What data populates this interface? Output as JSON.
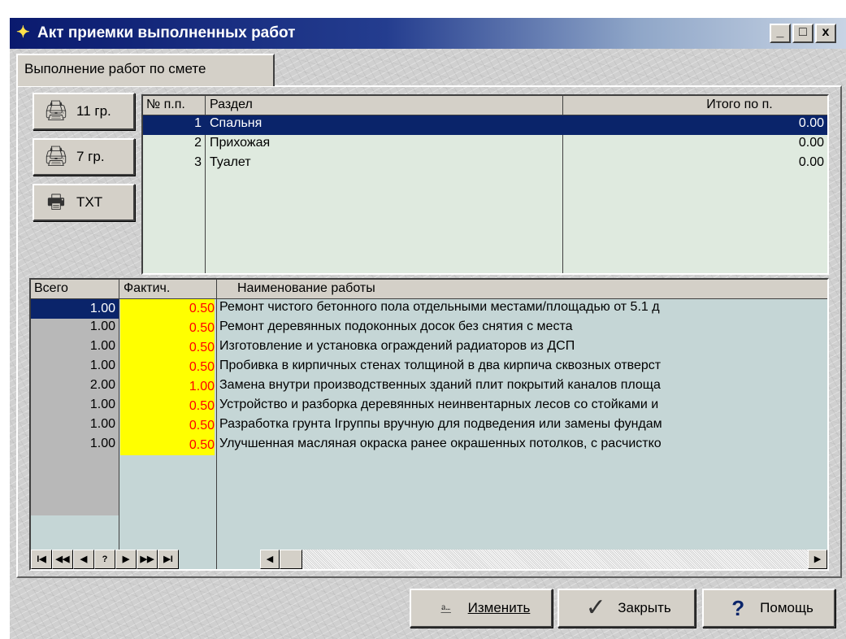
{
  "window": {
    "title": "Акт приемки выполненных работ",
    "controls": [
      "_",
      "□",
      "x"
    ]
  },
  "tab": {
    "label": "Выполнение работ по смете"
  },
  "side_buttons": [
    {
      "label": "11 гр.",
      "icon": "printer-icon"
    },
    {
      "label": "7 гр.",
      "icon": "printer-icon"
    },
    {
      "label": "TXT",
      "icon": "printer-icon"
    }
  ],
  "sections": {
    "headers": {
      "num": "№ п.п.",
      "section": "Раздел",
      "total": "Итого по п."
    },
    "rows": [
      {
        "num": "1",
        "name": "Спальня",
        "total": "0.00"
      },
      {
        "num": "2",
        "name": "Прихожая",
        "total": "0.00"
      },
      {
        "num": "3",
        "name": "Туалет",
        "total": "0.00"
      }
    ]
  },
  "works": {
    "headers": {
      "total": "Всего",
      "actual": "Фактич.",
      "name": "Наименование работы"
    },
    "rows": [
      {
        "total": "1.00",
        "actual": "0.50",
        "name": "Ремонт чистого бетонного пола отдельными местами/площадью от 5.1 д"
      },
      {
        "total": "1.00",
        "actual": "0.50",
        "name": "Ремонт деревянных подоконных досок без снятия с места"
      },
      {
        "total": "1.00",
        "actual": "0.50",
        "name": "Изготовление и установка ограждений радиаторов из ДСП"
      },
      {
        "total": "1.00",
        "actual": "0.50",
        "name": "Пробивка в кирпичных стенах толщиной в два кирпича сквозных отверст"
      },
      {
        "total": "2.00",
        "actual": "1.00",
        "name": "Замена внутри производственных зданий плит покрытий каналов площа"
      },
      {
        "total": "1.00",
        "actual": "0.50",
        "name": "Устройство и разборка деревянных неинвентарных лесов со стойками и"
      },
      {
        "total": "1.00",
        "actual": "0.50",
        "name": "Разработка грунта Iгруппы  вручную для подведения или замены фундам"
      },
      {
        "total": "1.00",
        "actual": "0.50",
        "name": "Улучшенная масляная окраска ранее окрашенных потолков, с расчистко"
      }
    ]
  },
  "navigator": {
    "buttons": [
      "I◀",
      "◀◀",
      "◀",
      "?",
      "▶",
      "▶▶",
      "▶I"
    ]
  },
  "buttons": {
    "edit": "Изменить",
    "close": "Закрыть",
    "help": "Помощь"
  },
  "colors": {
    "title_start": "#0a1a6e",
    "selection": "#0a246a",
    "highlight_cell": "#ffff00",
    "highlight_text": "#ff0000",
    "grid_bg": "#dfeadf"
  }
}
